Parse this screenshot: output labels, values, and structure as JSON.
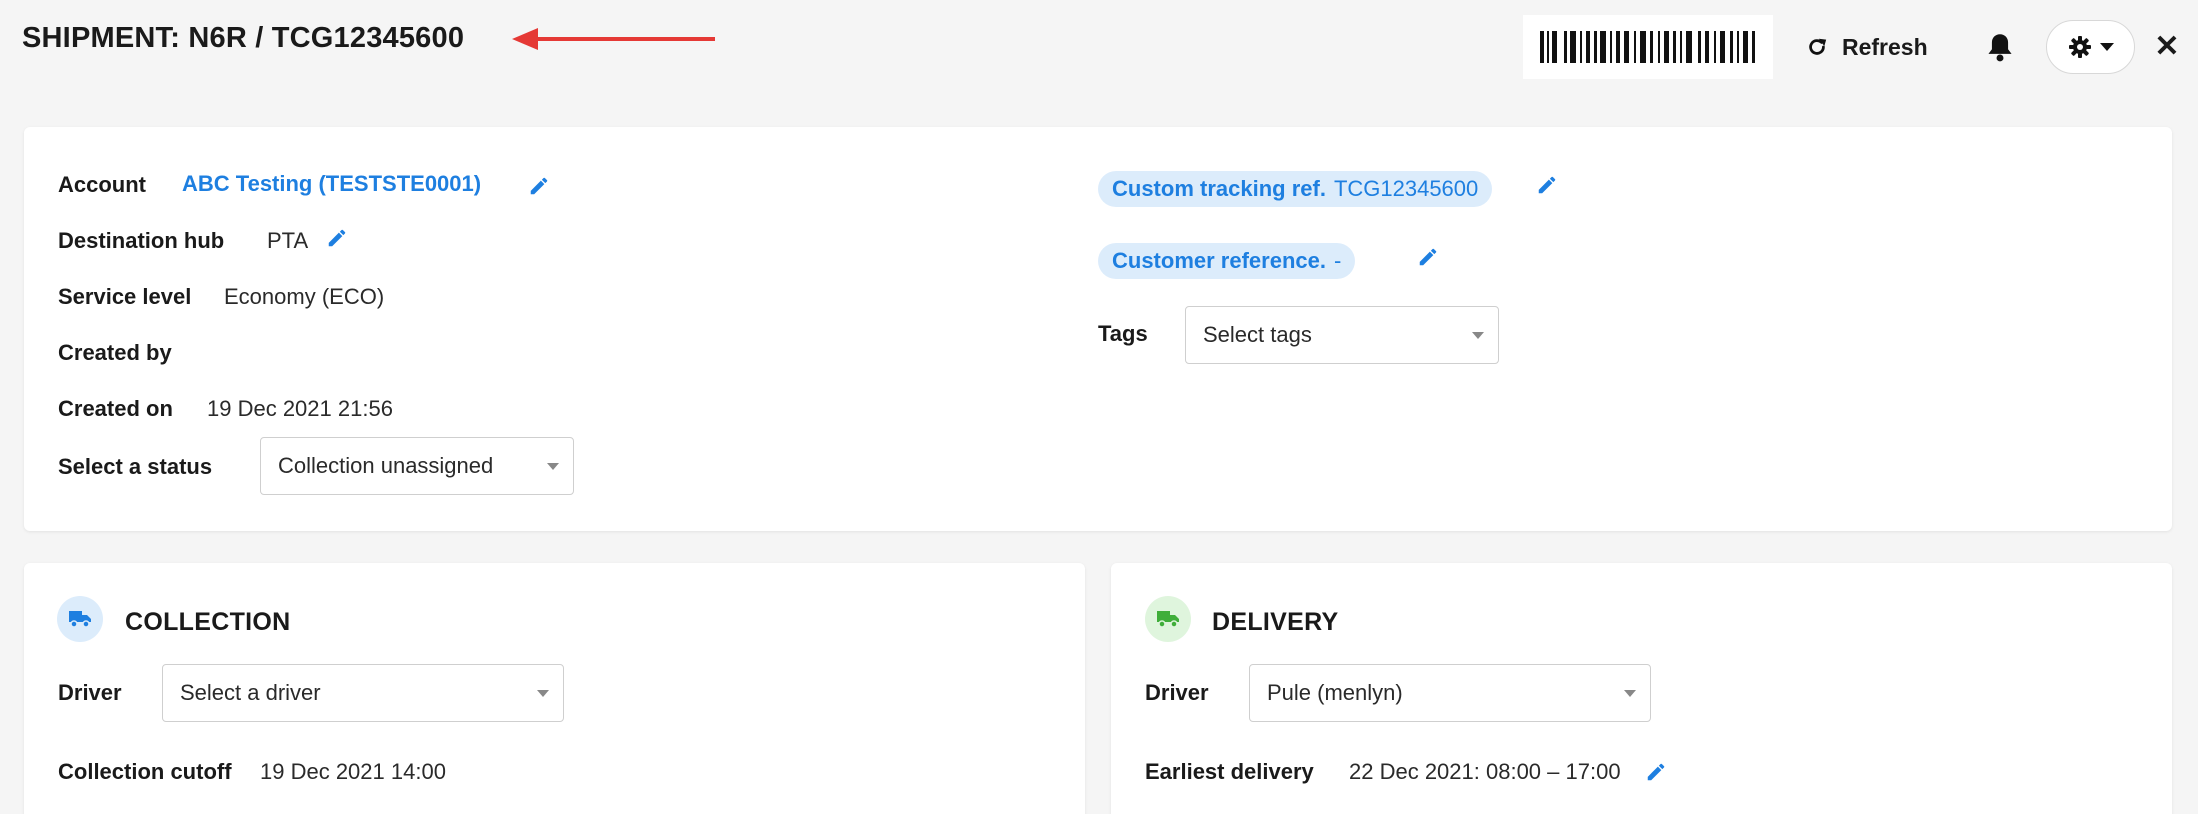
{
  "header": {
    "title": "SHIPMENT: N6R / TCG12345600",
    "refresh_label": "Refresh",
    "icons": {
      "arrow": "arrow-left-icon",
      "barcode": "barcode-icon",
      "refresh": "refresh-icon",
      "bell": "bell-icon",
      "settings": "gear-icon",
      "close": "close-icon"
    },
    "close_glyph": "✕"
  },
  "details": {
    "account_label": "Account",
    "account_value": "ABC Testing (TESTSTE0001)",
    "destination_hub_label": "Destination hub",
    "destination_hub_value": "PTA",
    "service_level_label": "Service level",
    "service_level_value": "Economy (ECO)",
    "created_by_label": "Created by",
    "created_by_value": "",
    "created_on_label": "Created on",
    "created_on_value": "19 Dec 2021 21:56",
    "status_label": "Select a status",
    "status_value": "Collection unassigned"
  },
  "references": {
    "custom_tracking_label": "Custom tracking ref.",
    "custom_tracking_value": "TCG12345600",
    "customer_reference_label": "Customer reference.",
    "customer_reference_value": "-",
    "tags_label": "Tags",
    "tags_placeholder": "Select tags"
  },
  "collection": {
    "title": "COLLECTION",
    "driver_label": "Driver",
    "driver_value": "Select a driver",
    "cutoff_label": "Collection cutoff",
    "cutoff_value": "19 Dec 2021 14:00"
  },
  "delivery": {
    "title": "DELIVERY",
    "driver_label": "Driver",
    "driver_value": "Pule (menlyn)",
    "earliest_label": "Earliest delivery",
    "earliest_value": "22 Dec 2021: 08:00 – 17:00"
  },
  "colors": {
    "accent_blue": "#1e7fe0",
    "pill_bg": "#dcecfb",
    "arrow_red": "#e53935",
    "collection_icon_bg": "#dcecfb",
    "delivery_icon_bg": "#dff5dd",
    "delivery_icon": "#3fae3a"
  }
}
